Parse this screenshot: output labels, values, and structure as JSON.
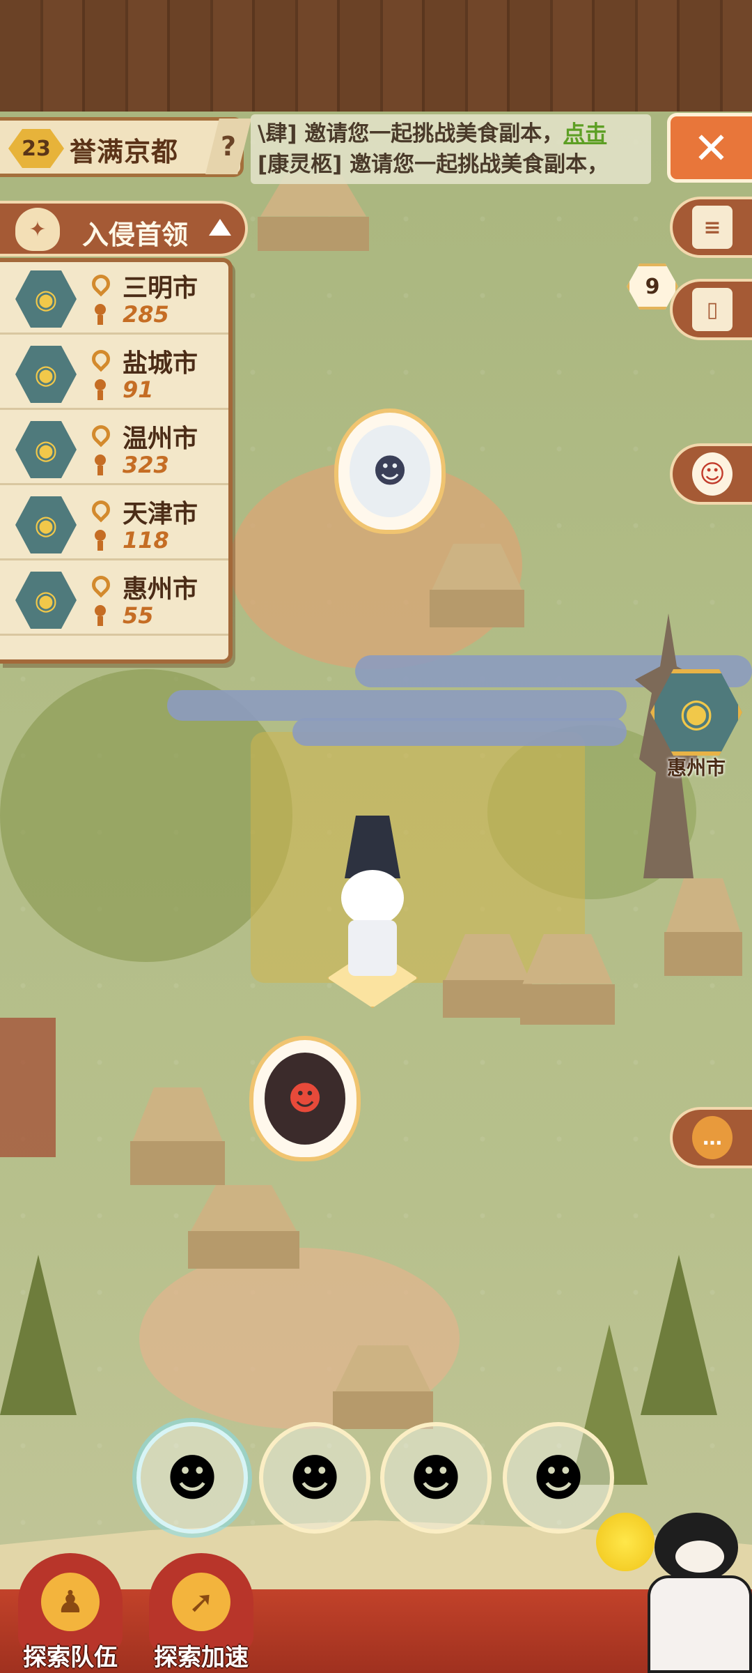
{
  "top_bar": {
    "level": "23",
    "area_name": "誉满京都",
    "help_icon": "question-icon",
    "close_icon": "close-icon"
  },
  "ticker": {
    "line1_prefix": "\\肆] 邀请您一起挑战美食副本，",
    "line1_link": "点击",
    "line2": "[康灵柩] 邀请您一起挑战美食副本，"
  },
  "invasion": {
    "title": "入侵首领",
    "rows": [
      {
        "city": "三明市",
        "count": "285"
      },
      {
        "city": "盐城市",
        "count": "91"
      },
      {
        "city": "温州市",
        "count": "323"
      },
      {
        "city": "天津市",
        "count": "118"
      },
      {
        "city": "惠州市",
        "count": "55"
      }
    ]
  },
  "side_buttons": {
    "card_count": "9",
    "icons": [
      "scroll-icon",
      "card-icon",
      "mask-icon",
      "chat-icon"
    ]
  },
  "map": {
    "boss_city_label": "惠州市"
  },
  "bottom": {
    "team_label": "探索队伍",
    "speed_label": "探索加速"
  },
  "colors": {
    "wood": "#6b4226",
    "panel": "#f3e7c9",
    "accent_orange": "#e8763a",
    "boss_teal": "#4f7a7c",
    "link_green": "#5d9f24"
  }
}
